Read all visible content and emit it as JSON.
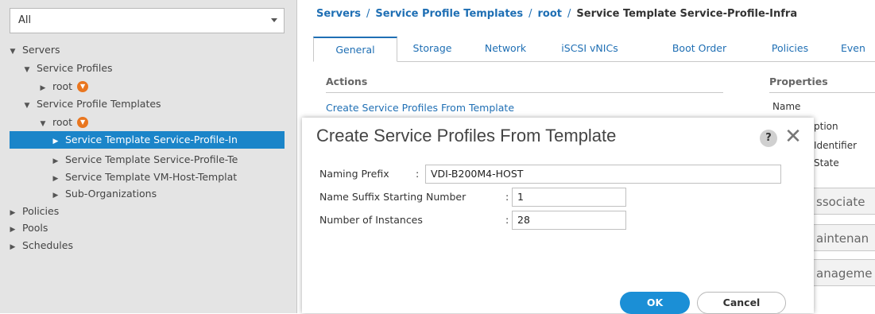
{
  "nav": {
    "filter": "All",
    "tree": [
      {
        "label": "Servers",
        "arrow": "▼",
        "indent": 0
      },
      {
        "label": "Service Profiles",
        "arrow": "▼",
        "indent": 1
      },
      {
        "label": "root",
        "arrow": "▶",
        "indent": 2,
        "icon": "org"
      },
      {
        "label": "Service Profile Templates",
        "arrow": "▼",
        "indent": 1
      },
      {
        "label": "root",
        "arrow": "▼",
        "indent": 2,
        "icon": "org"
      },
      {
        "label": "Service Template Service-Profile-In",
        "arrow": "▶",
        "indent": 3,
        "selected": true
      },
      {
        "label": "Service Template Service-Profile-Te",
        "arrow": "▶",
        "indent": 3
      },
      {
        "label": "Service Template VM-Host-Templat",
        "arrow": "▶",
        "indent": 3
      },
      {
        "label": "Sub-Organizations",
        "arrow": "▶",
        "indent": 3
      },
      {
        "label": "Policies",
        "arrow": "▶",
        "indent": 0
      },
      {
        "label": "Pools",
        "arrow": "▶",
        "indent": 0
      },
      {
        "label": "Schedules",
        "arrow": "▶",
        "indent": 0
      }
    ]
  },
  "breadcrumb": {
    "items": [
      "Servers",
      "Service Profile Templates",
      "root"
    ],
    "current": "Service Template Service-Profile-Infra",
    "separator": "/"
  },
  "tabs": [
    "General",
    "Storage",
    "Network",
    "iSCSI vNICs",
    "Boot Order",
    "Policies",
    "Even"
  ],
  "actions": {
    "title": "Actions",
    "create_link": "Create Service Profiles From Template"
  },
  "properties": {
    "title": "Properties",
    "labels": [
      "Name",
      "ption",
      "Identifier",
      "State"
    ],
    "boxes": [
      "ssociate",
      "aintenan",
      "anageme"
    ]
  },
  "dialog": {
    "title": "Create Service Profiles From Template",
    "help_glyph": "?",
    "close_glyph": "✕",
    "fields": [
      {
        "label": "Naming Prefix",
        "value": "VDI-B200M4-HOST"
      },
      {
        "label": "Name Suffix Starting Number",
        "value": "1"
      },
      {
        "label": "Number of Instances",
        "value": "28"
      }
    ],
    "ok_label": "OK",
    "cancel_label": "Cancel"
  },
  "colors": {
    "accent": "#1f6fb4",
    "selection": "#1b85c9",
    "ok_button": "#1b8fd6",
    "org_icon": "#e9761f"
  }
}
